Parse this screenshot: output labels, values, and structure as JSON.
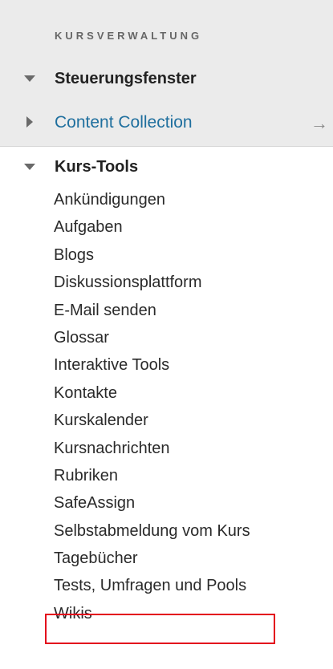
{
  "panel": {
    "section_title": "KURSVERWALTUNG",
    "steuerungsfenster": "Steuerungsfenster",
    "content_collection": "Content Collection",
    "kurs_tools": "Kurs-Tools"
  },
  "tools": [
    "Ankündigungen",
    "Aufgaben",
    "Blogs",
    "Diskussionsplattform",
    "E-Mail senden",
    "Glossar",
    "Interaktive Tools",
    "Kontakte",
    "Kurskalender",
    "Kursnachrichten",
    "Rubriken",
    "SafeAssign",
    "Selbstabmeldung vom Kurs",
    "Tagebücher",
    "Tests, Umfragen und Pools",
    "Wikis"
  ],
  "icons": {
    "expanded": "triangle-down-icon",
    "collapsed": "triangle-right-icon",
    "arrow": "arrow-right-icon"
  },
  "arrow_glyph": "→",
  "colors": {
    "header_bg": "#ebebeb",
    "link": "#1f6f9e",
    "highlight_border": "#e3001b"
  }
}
